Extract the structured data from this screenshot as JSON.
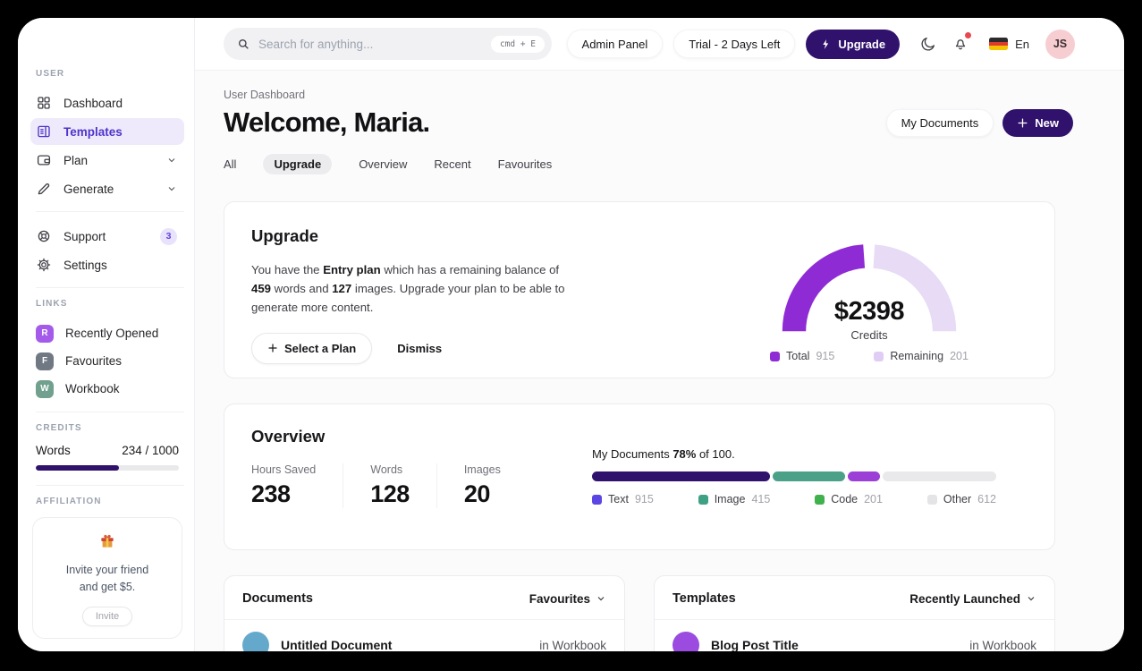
{
  "colors": {
    "brand": "#30126d",
    "gauge_purple": "#8f2bd4",
    "gauge_lavender": "#e7dbf5",
    "bar_dark": "#30126d",
    "bar_teal": "#4ba188",
    "bar_purple": "#9b3fd6",
    "bar_track": "#e9e9eb",
    "legend_text_sq": "#5b46e4",
    "legend_image_sq": "#3ea183",
    "legend_code_sq": "#41b14e",
    "legend_other_sq": "#e4e4e7",
    "active_nav": "#4e34cb",
    "notification_dot": "#e8484f"
  },
  "topbar": {
    "search_placeholder": "Search for anything...",
    "search_shortcut": "cmd + E",
    "admin_panel": "Admin Panel",
    "trial": "Trial - 2 Days Left",
    "upgrade": "Upgrade",
    "language": "En",
    "avatar_initials": "JS"
  },
  "sidebar": {
    "section_user": "USER",
    "nav": [
      "Dashboard",
      "Templates",
      "Plan",
      "Generate"
    ],
    "support": "Support",
    "support_badge": "3",
    "settings": "Settings",
    "section_links": "LINKS",
    "links": [
      {
        "initial": "R",
        "label": "Recently Opened"
      },
      {
        "initial": "F",
        "label": "Favourites"
      },
      {
        "initial": "W",
        "label": "Workbook"
      }
    ],
    "section_credits": "CREDITS",
    "credits": {
      "label": "Words",
      "value": "234 / 1000",
      "used": 234,
      "total": 1000
    },
    "section_affiliation": "AFFILIATION",
    "affiliation": {
      "line1": "Invite your friend",
      "line2": "and get $5.",
      "button": "Invite"
    }
  },
  "header": {
    "breadcrumb": "User Dashboard",
    "title": "Welcome, Maria.",
    "my_documents": "My Documents",
    "new_button": "New",
    "tabs": [
      "All",
      "Upgrade",
      "Overview",
      "Recent",
      "Favourites"
    ],
    "active_tab": "Upgrade"
  },
  "upgrade_card": {
    "title": "Upgrade",
    "text": {
      "p1": "You have the ",
      "b1": "Entry plan",
      "p2": " which has a remaining balance of ",
      "b2": "459",
      "p3": " words and ",
      "b3": "127",
      "p4": " images. Upgrade your plan to be able to generate more content."
    },
    "select_plan": "Select a Plan",
    "dismiss": "Dismiss",
    "gauge": {
      "amount": "$2398",
      "caption": "Credits",
      "legend": [
        {
          "label": "Total",
          "value": "915"
        },
        {
          "label": "Remaining",
          "value": "201"
        }
      ]
    }
  },
  "overview_card": {
    "title": "Overview",
    "stats": [
      {
        "label": "Hours Saved",
        "value": "238"
      },
      {
        "label": "Words",
        "value": "128"
      },
      {
        "label": "Images",
        "value": "20"
      }
    ],
    "progress": {
      "prefix": "My Documents ",
      "percent": "78%",
      "suffix": " of 100."
    },
    "bar_segments": [
      {
        "label": "Text",
        "value": 915,
        "width_pct": 44
      },
      {
        "label": "Image",
        "value": 415,
        "width_pct": 18
      },
      {
        "label": "Code",
        "value": 201,
        "width_pct": 8
      },
      {
        "label": "Other",
        "value": 612,
        "width_pct": 30
      }
    ],
    "legend": [
      {
        "label": "Text",
        "value": "915"
      },
      {
        "label": "Image",
        "value": "415"
      },
      {
        "label": "Code",
        "value": "201"
      },
      {
        "label": "Other",
        "value": "612"
      }
    ]
  },
  "documents_card": {
    "title": "Documents",
    "filter": "Favourites",
    "rows": [
      {
        "title": "Untitled Document",
        "location": "in Workbook"
      }
    ]
  },
  "templates_card": {
    "title": "Templates",
    "filter": "Recently Launched",
    "rows": [
      {
        "title": "Blog Post Title",
        "location": "in Workbook"
      }
    ]
  }
}
